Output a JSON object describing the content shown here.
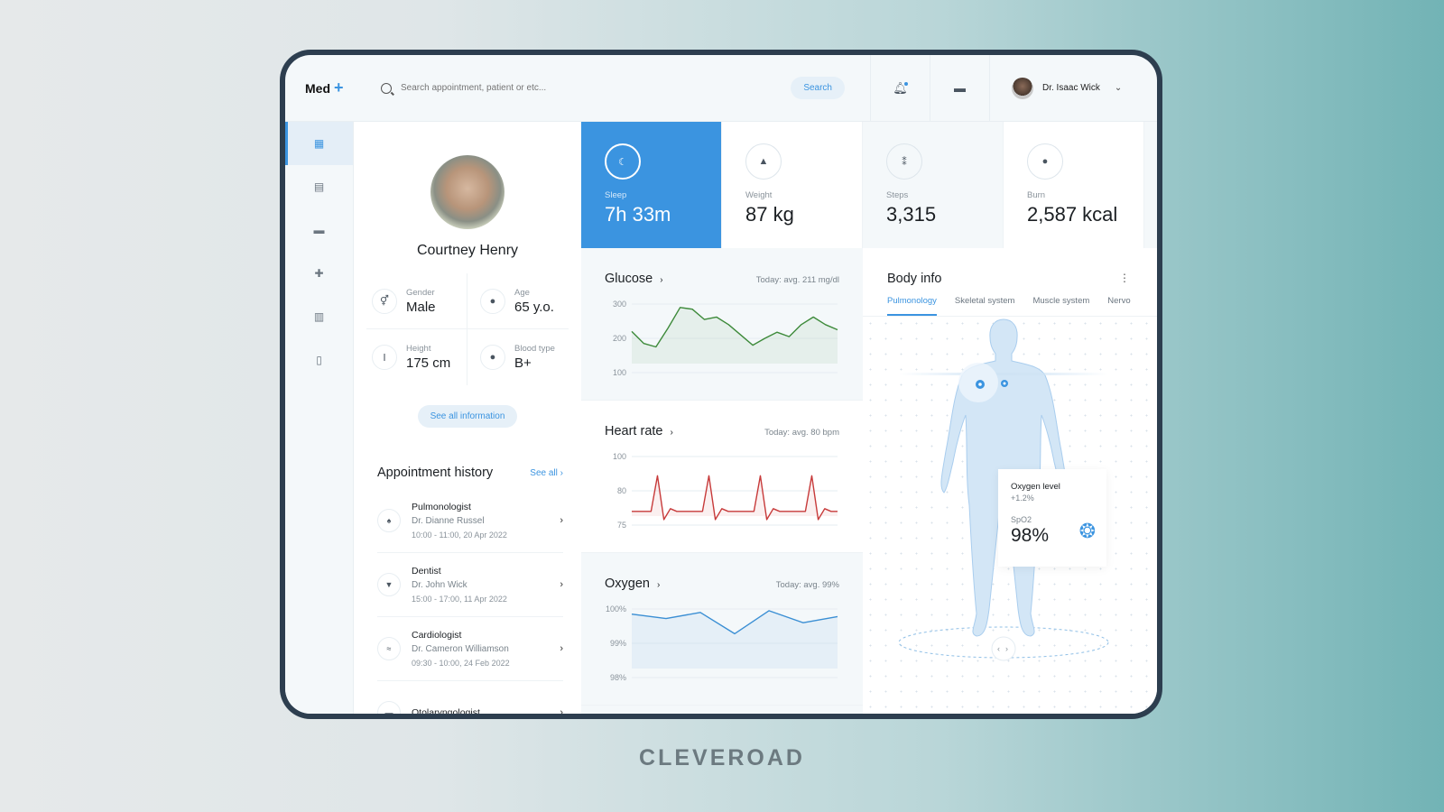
{
  "app": {
    "logo": "Med",
    "logo_plus": "+"
  },
  "search": {
    "placeholder": "Search appointment, patient or etc...",
    "button": "Search"
  },
  "topbar": {
    "bell_icon": "bell-icon",
    "chat_icon": "message-icon",
    "user_name": "Dr. Isaac Wick",
    "chevron": "⌄"
  },
  "sidebar": {
    "items": [
      {
        "icon": "▦",
        "name": "dashboard",
        "active": true
      },
      {
        "icon": "▤",
        "name": "calendar"
      },
      {
        "icon": "▬",
        "name": "messages"
      },
      {
        "icon": "✚",
        "name": "medical"
      },
      {
        "icon": "▥",
        "name": "reports"
      },
      {
        "icon": "▯",
        "name": "documents"
      }
    ]
  },
  "patient": {
    "name": "Courtney Henry",
    "info": [
      {
        "label": "Gender",
        "value": "Male",
        "icon": "⚥"
      },
      {
        "label": "Age",
        "value": "65 y.o.",
        "icon": "●"
      },
      {
        "label": "Height",
        "value": "175 cm",
        "icon": "Ⅰ"
      },
      {
        "label": "Blood type",
        "value": "B+",
        "icon": "●"
      }
    ],
    "see_all_info": "See all information"
  },
  "appointments": {
    "title": "Appointment history",
    "see_all": "See all",
    "items": [
      {
        "specialty": "Pulmonologist",
        "doctor": "Dr. Dianne Russel",
        "time": "10:00 - 11:00, 20 Apr 2022",
        "icon": "♠"
      },
      {
        "specialty": "Dentist",
        "doctor": "Dr. John Wick",
        "time": "15:00 - 17:00, 11 Apr 2022",
        "icon": "▼"
      },
      {
        "specialty": "Cardiologist",
        "doctor": "Dr. Cameron Williamson",
        "time": "09:30 - 10:00, 24 Feb 2022",
        "icon": "≈"
      },
      {
        "specialty": "Otolaryngologist",
        "doctor": "",
        "time": "",
        "icon": "▬"
      }
    ]
  },
  "stats": [
    {
      "label": "Sleep",
      "value": "7h 33m",
      "icon": "☾"
    },
    {
      "label": "Weight",
      "value": "87 kg",
      "icon": "▲"
    },
    {
      "label": "Steps",
      "value": "3,315",
      "icon": "⁑"
    },
    {
      "label": "Burn",
      "value": "2,587 kcal",
      "icon": "●"
    }
  ],
  "chart_data": [
    {
      "type": "line",
      "title": "Glucose",
      "summary": "Today: avg. 211 mg/dl",
      "color": "#3d8a3a",
      "yticks": [
        "300",
        "200",
        "100"
      ],
      "ylim": [
        100,
        300
      ],
      "values": [
        220,
        185,
        175,
        230,
        290,
        285,
        255,
        262,
        240,
        210,
        180,
        200,
        218,
        205,
        240,
        262,
        240,
        225
      ]
    },
    {
      "type": "line",
      "title": "Heart rate",
      "summary": "Today: avg. 80 bpm",
      "color": "#c73a3a",
      "yticks": [
        "100",
        "80",
        "75"
      ],
      "ylim": [
        75,
        100
      ],
      "values": [
        80,
        80,
        80,
        80,
        93,
        77,
        81,
        80,
        80,
        80,
        80,
        80,
        93,
        77,
        81,
        80,
        80,
        80,
        80,
        80,
        93,
        77,
        81,
        80,
        80,
        80,
        80,
        80,
        93,
        77,
        81,
        80,
        80
      ]
    },
    {
      "type": "line",
      "title": "Oxygen",
      "summary": "Today: avg. 99%",
      "color": "#3b8fd4",
      "yticks": [
        "100%",
        "99%",
        "98%"
      ],
      "ylim": [
        98,
        100
      ],
      "values": [
        99.85,
        99.72,
        99.9,
        99.28,
        99.95,
        99.6,
        99.78
      ]
    }
  ],
  "body_info": {
    "title": "Body info",
    "tabs": [
      "Pulmonology",
      "Skeletal system",
      "Muscle system",
      "Nervo"
    ],
    "oxygen_label": "Oxygen level",
    "oxygen_change": "+1.2%",
    "spo2_label": "SpO2",
    "spo2_value": "98%"
  },
  "brand": "CLEVEROAD"
}
